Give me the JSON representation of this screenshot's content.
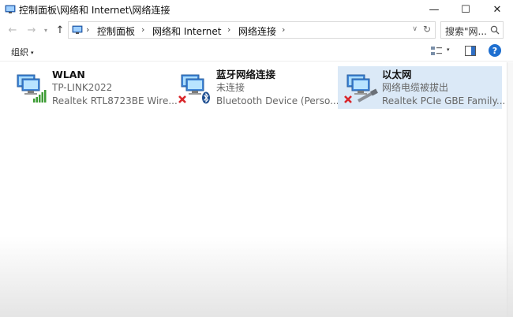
{
  "window": {
    "title": "控制面板\\网络和 Internet\\网络连接",
    "minimize": "—",
    "maximize": "☐",
    "close": "✕"
  },
  "nav": {
    "back": "←",
    "forward": "→",
    "history": "▾",
    "up": "↑"
  },
  "address": {
    "crumbs": [
      "控制面板",
      "网络和 Internet",
      "网络连接"
    ],
    "separator": "›",
    "dropdown": "∨",
    "refresh": "↻"
  },
  "search": {
    "placeholder": "搜索\"网..."
  },
  "toolbar": {
    "organize": "组织",
    "organize_caret": "▾",
    "view_caret": "▾",
    "help": "?"
  },
  "connections": [
    {
      "name": "WLAN",
      "status": "TP-LINK2022",
      "device": "Realtek RTL8723BE Wire...",
      "icon": "wifi-adapter-icon",
      "selected": false
    },
    {
      "name": "蓝牙网络连接",
      "status": "未连接",
      "device": "Bluetooth Device (Perso...",
      "icon": "bluetooth-adapter-icon",
      "selected": false
    },
    {
      "name": "以太网",
      "status": "网络电缆被拔出",
      "device": "Realtek PCIe GBE Family...",
      "icon": "ethernet-adapter-icon",
      "selected": true
    }
  ],
  "colors": {
    "selection": "#dbe9f7",
    "accent": "#1e6fd0",
    "error": "#d9262b",
    "signal": "#3e9c35"
  }
}
